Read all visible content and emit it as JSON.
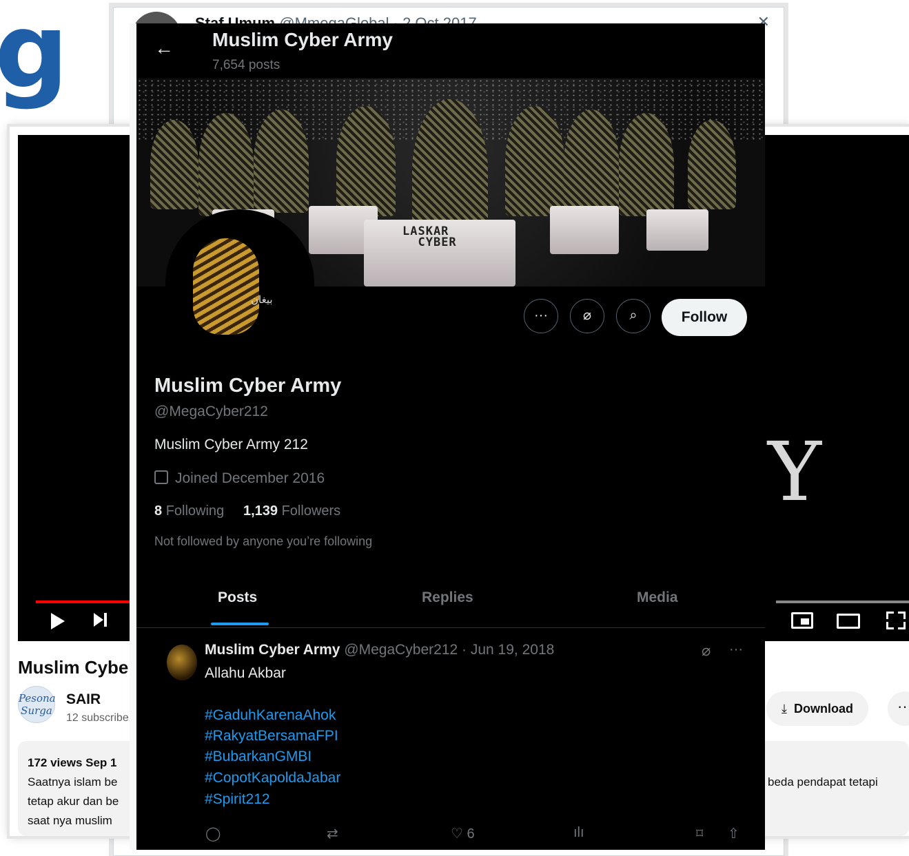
{
  "background": {
    "heading_letter": "g",
    "tweet_stub": {
      "name": "Staf Umum",
      "handle_date": "@MmegaGlobal · 2 Oct 2017"
    }
  },
  "youtube": {
    "video_big_text": "Y",
    "title": "Muslim Cybe",
    "channel": {
      "name": "SAIR",
      "avatar_text": "Pesona Surga",
      "subscribers": "12 subscribe"
    },
    "download_label": "Download",
    "more_label": "···",
    "description": {
      "stats": "172 views  Sep 1",
      "lines": [
        "Saatnya islam be",
        "tetap akur dan be",
        "saat nya muslim"
      ],
      "right_line": "beda pendapat tetapi"
    }
  },
  "twitter": {
    "header": {
      "name": "Muslim Cyber Army",
      "posts_count": "7,654 posts"
    },
    "banner_text": "LASKAR\nCYBER",
    "pfp_text": "بيغان",
    "actions": {
      "more": "···",
      "grok": "⌀",
      "search": "⌕",
      "follow": "Follow"
    },
    "profile": {
      "name": "Muslim Cyber Army",
      "handle": "@MegaCyber212",
      "bio": "Muslim Cyber Army 212",
      "joined": "Joined December 2016",
      "following_count": "8",
      "following_label": "Following",
      "followers_count": "1,139",
      "followers_label": "Followers",
      "not_followed": "Not followed by anyone you’re following"
    },
    "tabs": [
      "Posts",
      "Replies",
      "Media"
    ],
    "tweet": {
      "name": "Muslim Cyber Army",
      "meta": "@MegaCyber212 · Jun 19, 2018",
      "text": "Allahu Akbar",
      "hashtags": [
        "#GaduhKarenaAhok",
        "#RakyatBersamaFPI",
        "#BubarkanGMBI",
        "#CopotKapoldaJabar",
        "#Spirit212"
      ],
      "likes": "6"
    }
  },
  "colors": {
    "twitter_bg": "#000000",
    "twitter_link": "#1d9bf0",
    "twitter_muted": "#71767b",
    "youtube_progress": "#ff0000",
    "heading_blue": "#1f5fa8"
  }
}
